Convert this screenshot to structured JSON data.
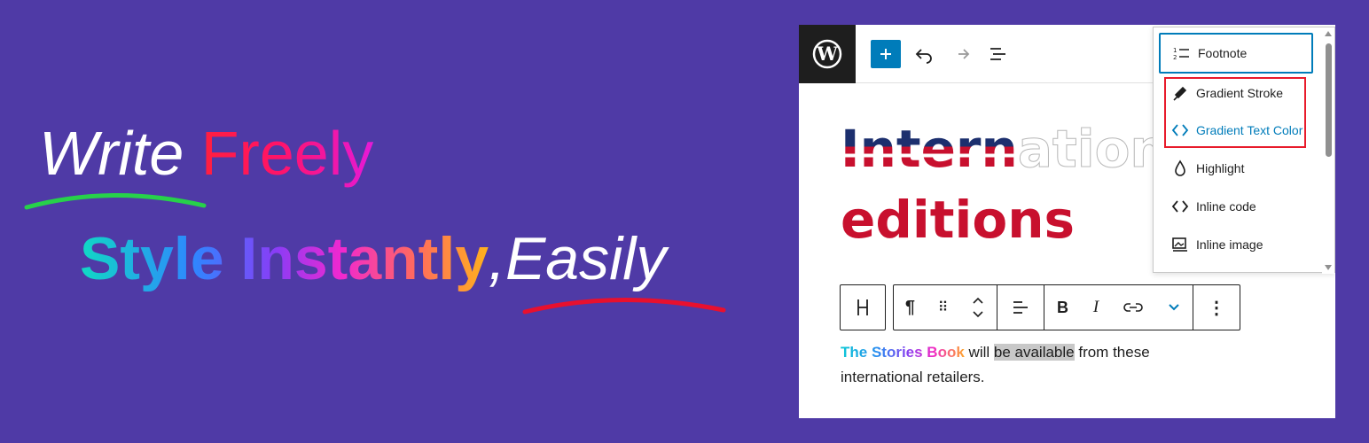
{
  "promo": {
    "line1_word1": "Write",
    "line1_word2": "Freely",
    "line2_styled": "Style Instantly",
    "line2_comma": ",",
    "line2_easily": "Easily",
    "colors": {
      "background": "#4f3aa6",
      "swoosh_green": "#27d14a",
      "swoosh_red": "#e8102e"
    }
  },
  "toolbar": {
    "logo_icon": "wordpress-logo-icon",
    "add_icon": "plus-icon",
    "undo_icon": "undo-icon",
    "redo_icon": "redo-icon",
    "outline_icon": "document-overview-icon"
  },
  "heading": {
    "line1_flag": "Intern",
    "line1_outline": "ation",
    "line2_red": "editions",
    "line2_outline": ""
  },
  "block_toolbar": {
    "transform_icon": "heading-icon",
    "paragraph_icon": "paragraph-icon",
    "drag_icon": "drag-handle-icon",
    "move_icon": "move-up-down-icon",
    "align_icon": "align-left-icon",
    "bold": "B",
    "italic": "I",
    "link_icon": "link-icon",
    "more_rich_icon": "chevron-down-icon",
    "options_icon": "more-vertical-icon"
  },
  "paragraph": {
    "styled": "The Stories Book",
    "text1": " will ",
    "highlighted": "be available",
    "text2": " from these international retailers."
  },
  "menu": {
    "items": [
      {
        "label": "Footnote",
        "icon": "footnote-icon"
      },
      {
        "label": "Gradient Stroke",
        "icon": "brush-icon"
      },
      {
        "label": "Gradient Text Color",
        "icon": "code-icon"
      },
      {
        "label": "Highlight",
        "icon": "drop-icon"
      },
      {
        "label": "Inline code",
        "icon": "code-icon"
      },
      {
        "label": "Inline image",
        "icon": "image-icon"
      }
    ]
  }
}
